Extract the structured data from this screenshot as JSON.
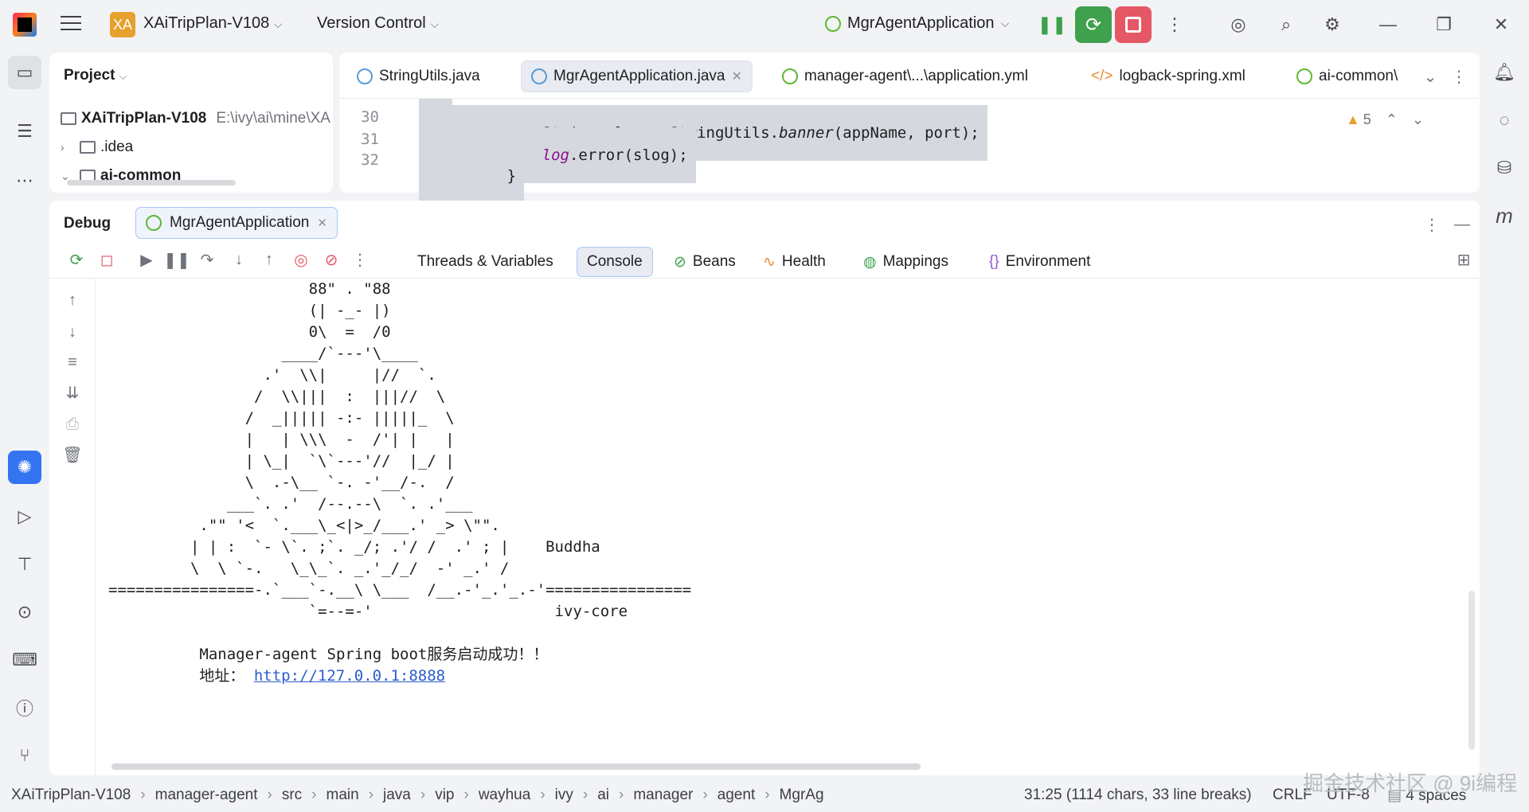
{
  "titlebar": {
    "project_badge": "XA",
    "project_name": "XAiTripPlan-V108",
    "vcs_label": "Version Control",
    "run_config": "MgrAgentApplication"
  },
  "project_panel": {
    "header": "Project",
    "root_name": "XAiTripPlan-V108",
    "root_path": "E:\\ivy\\ai\\mine\\XA",
    "items": [
      ".idea",
      "ai-common"
    ]
  },
  "editor": {
    "tabs": [
      {
        "label": "StringUtils.java"
      },
      {
        "label": "MgrAgentApplication.java"
      },
      {
        "label": "manager-agent\\...\\application.yml"
      },
      {
        "label": "logback-spring.xml"
      },
      {
        "label": "ai-common\\"
      }
    ],
    "warnings_count": "5",
    "lines": [
      {
        "num": "30",
        "code_pre": "String slog = StringUtils.",
        "code_italic": "banner",
        "code_post": "(appName, port);"
      },
      {
        "num": "31",
        "code_log": "log",
        "code_post": ".error(slog);"
      },
      {
        "num": "32",
        "code_post": "}"
      }
    ]
  },
  "debug": {
    "title": "Debug",
    "session_tab": "MgrAgentApplication",
    "view_tabs": [
      "Threads & Variables",
      "Console",
      "Beans",
      "Health",
      "Mappings",
      "Environment"
    ],
    "console_lines": [
      "                      88\" . \"88",
      "                      (| -_- |)",
      "                      0\\  =  /0",
      "                   ____/`---'\\____",
      "                 .'  \\\\|     |//  `.",
      "                /  \\\\|||  :  |||//  \\",
      "               /  _||||| -:- |||||_  \\",
      "               |   | \\\\\\  -  /'| |   |",
      "               | \\_|  `\\`---'//  |_/ |",
      "               \\  .-\\__ `-. -'__/-.  /",
      "             ___`. .'  /--.--\\  `. .'___",
      "          .\"\" '<  `.___\\_<|>_/___.' _> \\\"\".",
      "         | | :  `- \\`. ;`. _/; .'/ /  .' ; |    Buddha",
      "         \\  \\ `-.   \\_\\_`. _.'_/_/  -' _.' /",
      "================-.`___`-.__\\ \\___  /__.-'_.'_.-'================",
      "                      `=--=-'                    ivy-core"
    ],
    "success_message": "    Manager-agent Spring boot服务启动成功！！",
    "address_label": "    地址：",
    "address_url": "http://127.0.0.1:8888"
  },
  "statusbar": {
    "breadcrumbs": [
      "XAiTripPlan-V108",
      "manager-agent",
      "src",
      "main",
      "java",
      "vip",
      "wayhua",
      "ivy",
      "ai",
      "manager",
      "agent",
      "MgrAg"
    ],
    "position": "31:25 (1114 chars, 33 line breaks)",
    "line_ending": "CRLF",
    "encoding": "UTF-8",
    "indent": "4 spaces"
  },
  "watermark": "掘金技术社区 @ 9i编程",
  "colors": {
    "debug_active": "#3574f0",
    "rerun_green": "#3fa14d",
    "stop_red": "#e55765",
    "warning": "#e6a12e"
  }
}
